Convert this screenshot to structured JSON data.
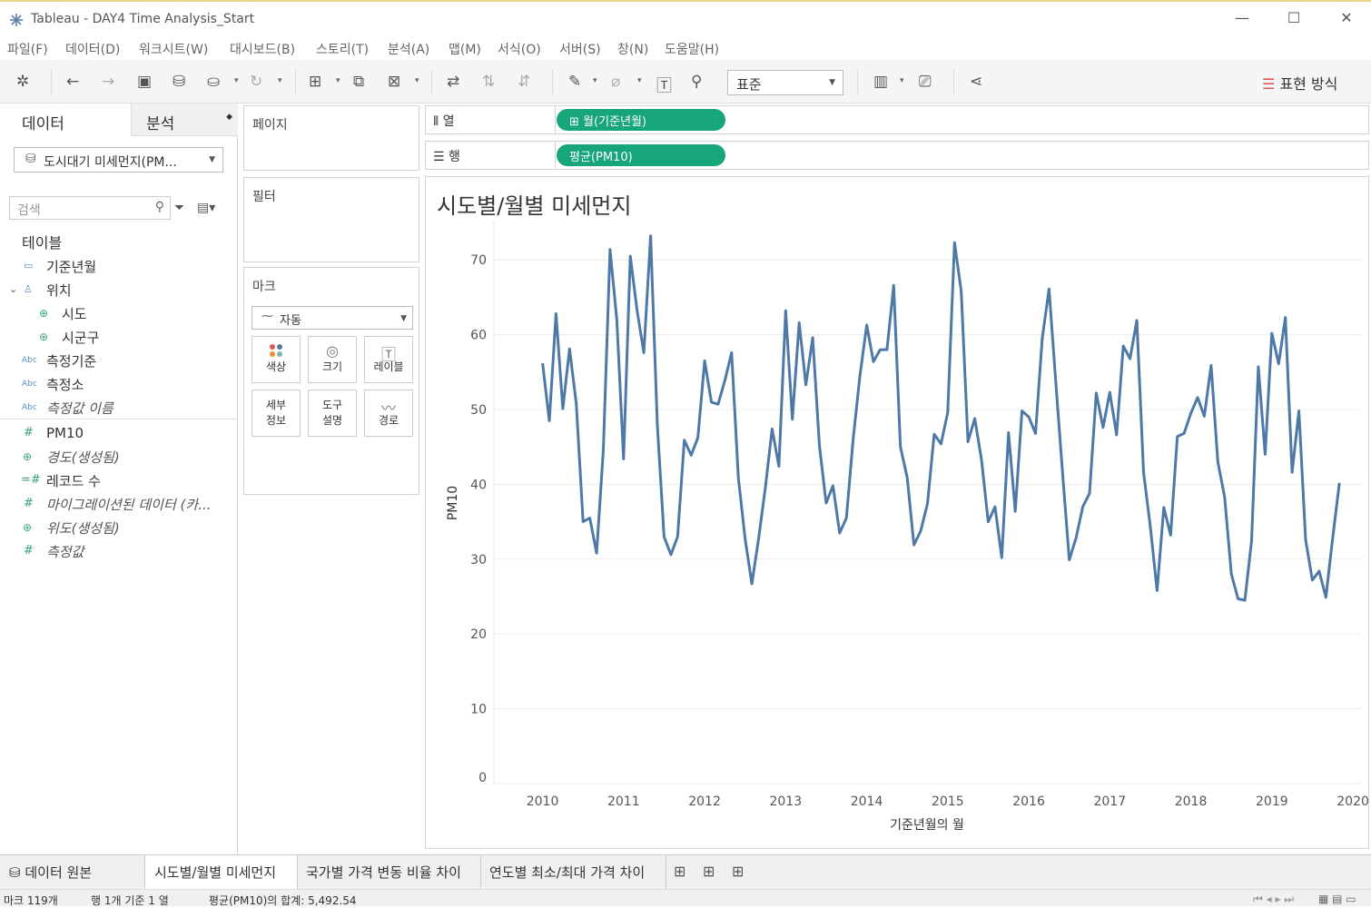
{
  "window": {
    "title": "Tableau - DAY4 Time Analysis_Start",
    "min": "—",
    "max": "☐",
    "close": "✕"
  },
  "menu": [
    "파일(F)",
    "데이터(D)",
    "워크시트(W)",
    "대시보드(B)",
    "스토리(T)",
    "분석(A)",
    "맵(M)",
    "서식(O)",
    "서버(S)",
    "창(N)",
    "도움말(H)"
  ],
  "toolbar": {
    "fit_value": "표준",
    "show_me": "표현 방식"
  },
  "datapane": {
    "tab_data": "데이터",
    "tab_analysis": "분석",
    "datasource": "도시대기 미세먼지(PM...",
    "search_placeholder": "검색",
    "section_tables": "테이블",
    "fields": [
      {
        "name": "기준년월",
        "icon": "calendar-icon"
      },
      {
        "name": "위치",
        "icon": "hierarchy-icon"
      },
      {
        "name": "시도",
        "icon": "globe-icon"
      },
      {
        "name": "시군구",
        "icon": "globe-icon"
      },
      {
        "name": "측정기준",
        "icon": "Abc"
      },
      {
        "name": "측정소",
        "icon": "Abc"
      },
      {
        "name": "측정값 이름",
        "icon": "Abc"
      },
      {
        "name": "PM10",
        "icon": "#"
      },
      {
        "name": "경도(생성됨)",
        "icon": "globe-icon"
      },
      {
        "name": "레코드 수",
        "icon": "=#"
      },
      {
        "name": "마이그레이션된 데이터 (카...",
        "icon": "#"
      },
      {
        "name": "위도(생성됨)",
        "icon": "globe-icon"
      },
      {
        "name": "측정값",
        "icon": "#"
      }
    ]
  },
  "shelves": {
    "pages": "페이지",
    "filters": "필터",
    "marks": "마크",
    "mark_type": "자동",
    "mark_buttons": [
      "색상",
      "크기",
      "레이블",
      "세부\n정보",
      "도구\n설명",
      "경로"
    ],
    "columns_label": "열",
    "rows_label": "행",
    "columns_pill": "월(기준년월)",
    "rows_pill": "평균(PM10)"
  },
  "view": {
    "sheet_title": "시도별/월별 미세먼지"
  },
  "chart_data": {
    "type": "line",
    "title": "시도별/월별 미세먼지",
    "xlabel": "기준년월의 월",
    "ylabel": "PM10",
    "ylim": [
      0,
      75
    ],
    "xlim": [
      2009.4,
      2020.1
    ],
    "y_ticks": [
      0,
      10,
      20,
      30,
      40,
      50,
      60,
      70
    ],
    "x_ticks": [
      2010,
      2011,
      2012,
      2013,
      2014,
      2015,
      2016,
      2017,
      2018,
      2019,
      2020
    ],
    "color": "#4e79a7",
    "series": [
      {
        "x_start": "2010-01",
        "interval": "month",
        "values": [
          56.2,
          48.5,
          62.8,
          50.1,
          58.1,
          50.8,
          35.0,
          35.5,
          30.8,
          44.6,
          71.4,
          61.9,
          43.4,
          70.5,
          63.2,
          57.6,
          73.2,
          47.9,
          33.0,
          30.6,
          33.0,
          45.9,
          43.9,
          46.2,
          56.5,
          51.0,
          50.7,
          53.9,
          57.6,
          40.9,
          32.7,
          26.7,
          32.8,
          39.6,
          47.4,
          42.4,
          63.2,
          48.7,
          61.6,
          53.3,
          59.6,
          45.2,
          37.5,
          39.8,
          33.5,
          35.5,
          46.1,
          54.5,
          61.3,
          56.4,
          58.0,
          58.0,
          66.6,
          45.0,
          40.9,
          31.9,
          33.8,
          37.4,
          46.7,
          45.4,
          49.6,
          72.3,
          65.8,
          45.7,
          48.8,
          43.3,
          35.0,
          37.0,
          30.2,
          46.9,
          36.4,
          49.8,
          49.0,
          46.8,
          59.5,
          66.1,
          53.7,
          41.5,
          29.9,
          32.8,
          37.0,
          38.8,
          52.2,
          47.6,
          52.3,
          46.6,
          58.5,
          56.8,
          61.9,
          41.6,
          34.4,
          25.8,
          36.9,
          33.2,
          46.4,
          46.8,
          49.5,
          51.6,
          49.1,
          55.9,
          43.0,
          38.3,
          28.0,
          24.7,
          24.5,
          32.5,
          55.7,
          44.0,
          60.2,
          56.1,
          62.3,
          41.6,
          49.8,
          32.6,
          27.2,
          28.4,
          24.9,
          32.8,
          40.2
        ]
      }
    ]
  },
  "bottom_tabs": {
    "datasource_tab": "데이터 원본",
    "sheets": [
      "시도별/월별 미세먼지",
      "국가별 가격 변동 비율 차이",
      "연도별 최소/최대 가격 차이"
    ]
  },
  "status": {
    "marks": "마크 119개",
    "rows": "행 1개 기준 1 열",
    "sum": "평균(PM10)의 합계: 5,492.54"
  }
}
